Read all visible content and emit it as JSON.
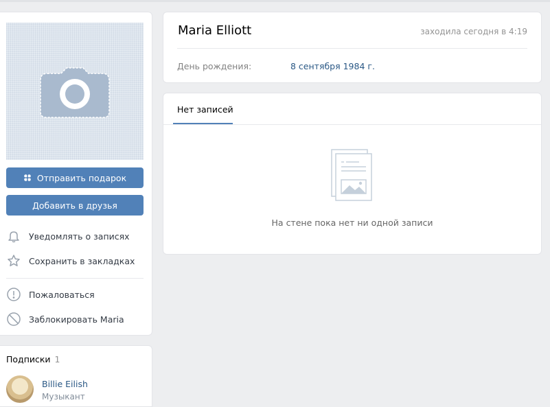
{
  "profile": {
    "name": "Maria Elliott",
    "last_seen": "заходила сегодня в 4:19",
    "birthday_label": "День рождения:",
    "birthday_value": "8 сентября 1984 г."
  },
  "actions": {
    "send_gift": "Отправить подарок",
    "add_friend": "Добавить в друзья",
    "notify": "Уведомлять о записях",
    "bookmark": "Сохранить в закладках",
    "report": "Пожаловаться",
    "block": "Заблокировать Maria"
  },
  "subscriptions": {
    "title": "Подписки",
    "count": "1",
    "items": [
      {
        "name": "Billie Eilish",
        "role": "Музыкант"
      }
    ]
  },
  "wall": {
    "tab": "Нет записей",
    "empty_text": "На стене пока нет ни одной записи"
  },
  "colors": {
    "accent": "#5181b8",
    "link": "#2a5885",
    "background": "#edeef0"
  }
}
